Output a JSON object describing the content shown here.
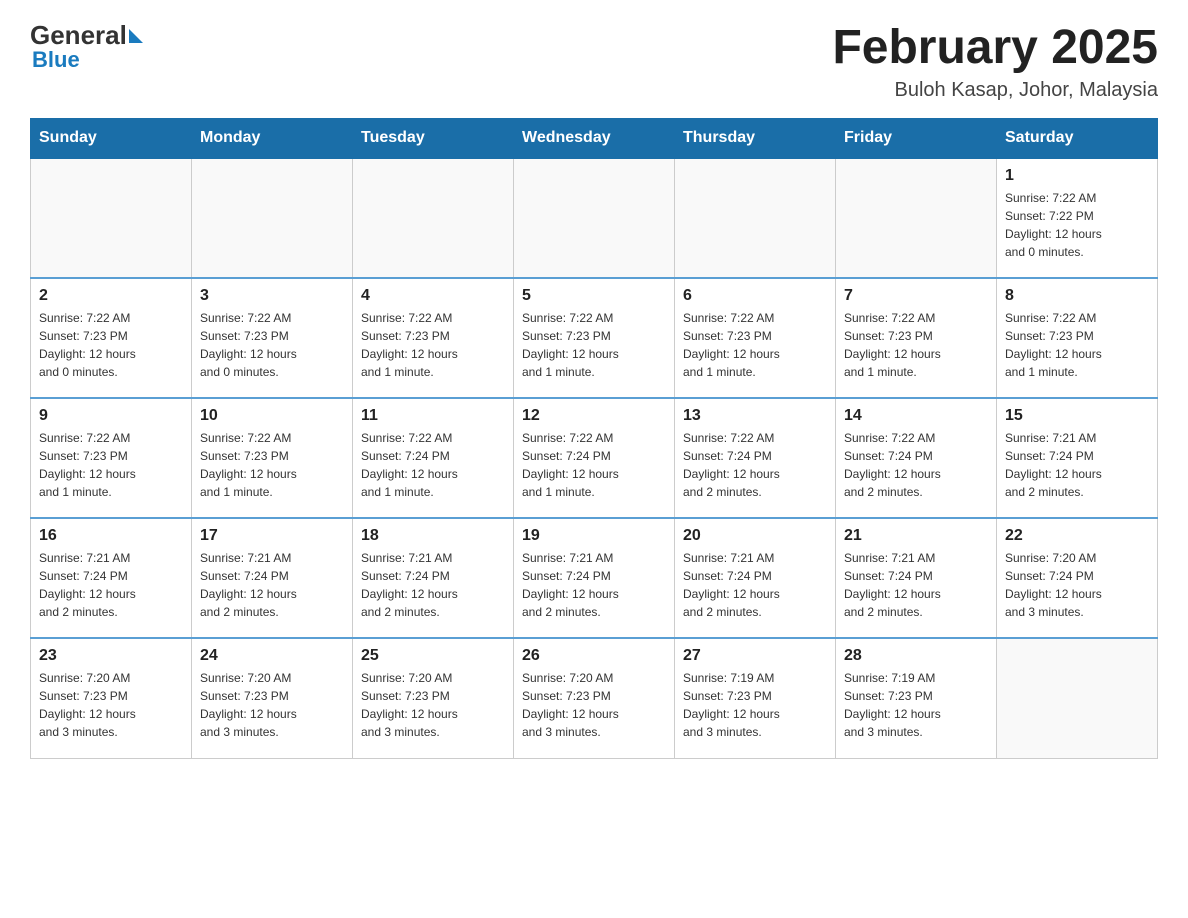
{
  "header": {
    "logo_main": "General",
    "logo_sub": "Blue",
    "title": "February 2025",
    "subtitle": "Buloh Kasap, Johor, Malaysia"
  },
  "weekdays": [
    "Sunday",
    "Monday",
    "Tuesday",
    "Wednesday",
    "Thursday",
    "Friday",
    "Saturday"
  ],
  "weeks": [
    [
      {
        "day": "",
        "info": ""
      },
      {
        "day": "",
        "info": ""
      },
      {
        "day": "",
        "info": ""
      },
      {
        "day": "",
        "info": ""
      },
      {
        "day": "",
        "info": ""
      },
      {
        "day": "",
        "info": ""
      },
      {
        "day": "1",
        "info": "Sunrise: 7:22 AM\nSunset: 7:22 PM\nDaylight: 12 hours\nand 0 minutes."
      }
    ],
    [
      {
        "day": "2",
        "info": "Sunrise: 7:22 AM\nSunset: 7:23 PM\nDaylight: 12 hours\nand 0 minutes."
      },
      {
        "day": "3",
        "info": "Sunrise: 7:22 AM\nSunset: 7:23 PM\nDaylight: 12 hours\nand 0 minutes."
      },
      {
        "day": "4",
        "info": "Sunrise: 7:22 AM\nSunset: 7:23 PM\nDaylight: 12 hours\nand 1 minute."
      },
      {
        "day": "5",
        "info": "Sunrise: 7:22 AM\nSunset: 7:23 PM\nDaylight: 12 hours\nand 1 minute."
      },
      {
        "day": "6",
        "info": "Sunrise: 7:22 AM\nSunset: 7:23 PM\nDaylight: 12 hours\nand 1 minute."
      },
      {
        "day": "7",
        "info": "Sunrise: 7:22 AM\nSunset: 7:23 PM\nDaylight: 12 hours\nand 1 minute."
      },
      {
        "day": "8",
        "info": "Sunrise: 7:22 AM\nSunset: 7:23 PM\nDaylight: 12 hours\nand 1 minute."
      }
    ],
    [
      {
        "day": "9",
        "info": "Sunrise: 7:22 AM\nSunset: 7:23 PM\nDaylight: 12 hours\nand 1 minute."
      },
      {
        "day": "10",
        "info": "Sunrise: 7:22 AM\nSunset: 7:23 PM\nDaylight: 12 hours\nand 1 minute."
      },
      {
        "day": "11",
        "info": "Sunrise: 7:22 AM\nSunset: 7:24 PM\nDaylight: 12 hours\nand 1 minute."
      },
      {
        "day": "12",
        "info": "Sunrise: 7:22 AM\nSunset: 7:24 PM\nDaylight: 12 hours\nand 1 minute."
      },
      {
        "day": "13",
        "info": "Sunrise: 7:22 AM\nSunset: 7:24 PM\nDaylight: 12 hours\nand 2 minutes."
      },
      {
        "day": "14",
        "info": "Sunrise: 7:22 AM\nSunset: 7:24 PM\nDaylight: 12 hours\nand 2 minutes."
      },
      {
        "day": "15",
        "info": "Sunrise: 7:21 AM\nSunset: 7:24 PM\nDaylight: 12 hours\nand 2 minutes."
      }
    ],
    [
      {
        "day": "16",
        "info": "Sunrise: 7:21 AM\nSunset: 7:24 PM\nDaylight: 12 hours\nand 2 minutes."
      },
      {
        "day": "17",
        "info": "Sunrise: 7:21 AM\nSunset: 7:24 PM\nDaylight: 12 hours\nand 2 minutes."
      },
      {
        "day": "18",
        "info": "Sunrise: 7:21 AM\nSunset: 7:24 PM\nDaylight: 12 hours\nand 2 minutes."
      },
      {
        "day": "19",
        "info": "Sunrise: 7:21 AM\nSunset: 7:24 PM\nDaylight: 12 hours\nand 2 minutes."
      },
      {
        "day": "20",
        "info": "Sunrise: 7:21 AM\nSunset: 7:24 PM\nDaylight: 12 hours\nand 2 minutes."
      },
      {
        "day": "21",
        "info": "Sunrise: 7:21 AM\nSunset: 7:24 PM\nDaylight: 12 hours\nand 2 minutes."
      },
      {
        "day": "22",
        "info": "Sunrise: 7:20 AM\nSunset: 7:24 PM\nDaylight: 12 hours\nand 3 minutes."
      }
    ],
    [
      {
        "day": "23",
        "info": "Sunrise: 7:20 AM\nSunset: 7:23 PM\nDaylight: 12 hours\nand 3 minutes."
      },
      {
        "day": "24",
        "info": "Sunrise: 7:20 AM\nSunset: 7:23 PM\nDaylight: 12 hours\nand 3 minutes."
      },
      {
        "day": "25",
        "info": "Sunrise: 7:20 AM\nSunset: 7:23 PM\nDaylight: 12 hours\nand 3 minutes."
      },
      {
        "day": "26",
        "info": "Sunrise: 7:20 AM\nSunset: 7:23 PM\nDaylight: 12 hours\nand 3 minutes."
      },
      {
        "day": "27",
        "info": "Sunrise: 7:19 AM\nSunset: 7:23 PM\nDaylight: 12 hours\nand 3 minutes."
      },
      {
        "day": "28",
        "info": "Sunrise: 7:19 AM\nSunset: 7:23 PM\nDaylight: 12 hours\nand 3 minutes."
      },
      {
        "day": "",
        "info": ""
      }
    ]
  ]
}
